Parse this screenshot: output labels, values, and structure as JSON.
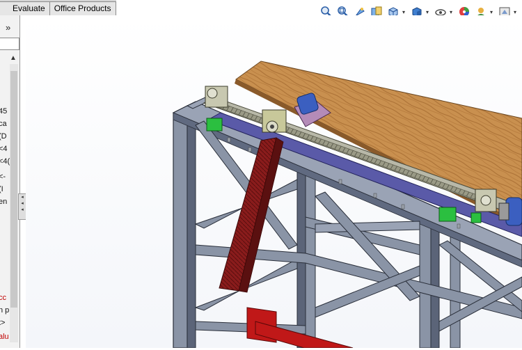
{
  "command_tabs": [
    {
      "label": "Evaluate"
    },
    {
      "label": "Office Products"
    }
  ],
  "feature_tree": {
    "expand_glyph": "»",
    "truncated_lines": [
      {
        "text": "45",
        "red": false
      },
      {
        "text": "ca",
        "red": false
      },
      {
        "text": "(D",
        "red": false
      },
      {
        "text": "<4",
        "red": false
      },
      {
        "text": "<4(",
        "red": false
      },
      {
        "text": "<-",
        "red": false
      },
      {
        "text": "(I",
        "red": false
      },
      {
        "text": "en",
        "red": false
      },
      {
        "text": "cc",
        "red": true
      },
      {
        "text": "n p",
        "red": false
      },
      {
        "text": "t>",
        "red": false
      },
      {
        "text": "alu",
        "red": true
      }
    ]
  },
  "hud_toolbar": {
    "icons": [
      "zoom-to-fit-icon",
      "zoom-to-area-icon",
      "previous-view-icon",
      "section-view-icon",
      "view-orientation-icon",
      "display-style-icon",
      "hide-show-items-icon",
      "edit-appearance-icon",
      "apply-scene-icon",
      "view-settings-icon"
    ]
  },
  "colors": {
    "frame": "#8a94a6",
    "frame_dark": "#5b6478",
    "wood": "#c9904f",
    "rail": "#5a5aa8",
    "leadscrew": "#8a8a78",
    "bracket": "#8a2020",
    "green": "#2bbf40",
    "motor": "#3b5fc0",
    "plate": "#b48bb8",
    "red_part": "#c01818"
  }
}
